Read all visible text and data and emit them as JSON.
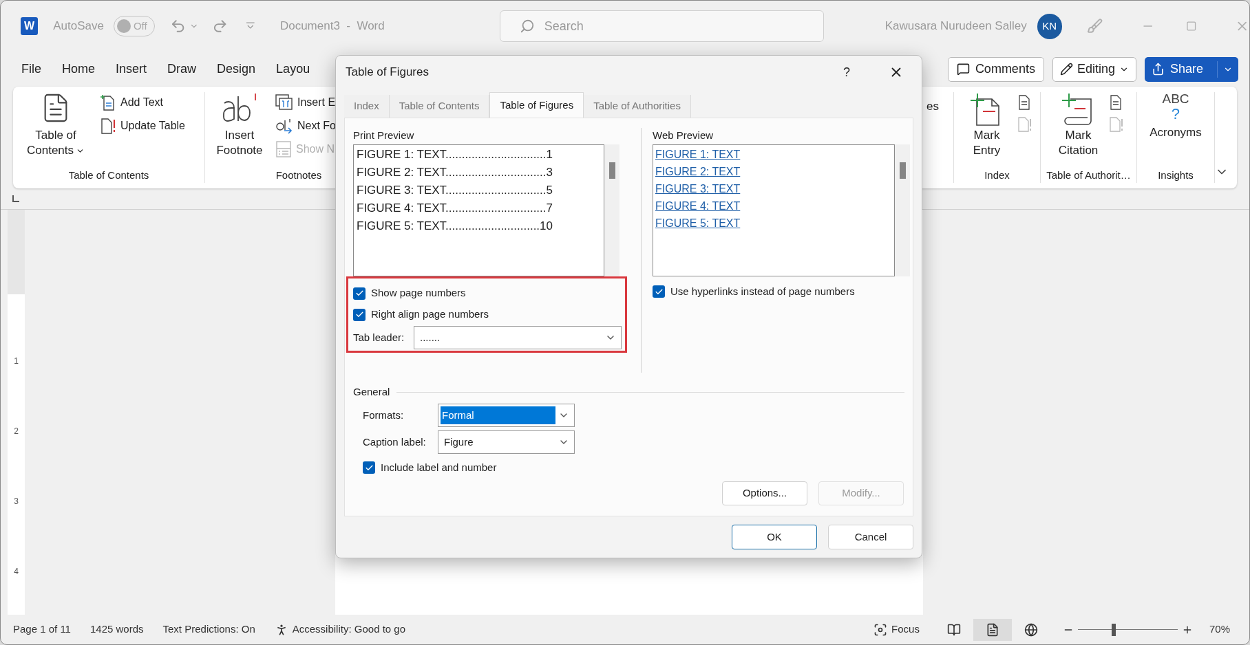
{
  "window": {
    "app_icon": "W",
    "autosave_label": "AutoSave",
    "autosave_toggle": {
      "label": "Off",
      "on": false
    },
    "document_title": "Document3  -  Word",
    "search_placeholder": "Search",
    "user_name": "Kawusara Nurudeen Salley",
    "user_initials": "KN"
  },
  "ribbon_tabs": [
    "File",
    "Home",
    "Insert",
    "Draw",
    "Design",
    "Layou"
  ],
  "header_buttons": [
    {
      "kind": "comments",
      "label": "Comments"
    },
    {
      "kind": "editing",
      "label": "Editing"
    },
    {
      "kind": "share",
      "label": "Share"
    }
  ],
  "ribbon_left": [
    {
      "label": "Table of Contents",
      "large": "Table of Contents",
      "small": [
        {
          "label": "Add Text",
          "kind": "add",
          "disabled": false
        },
        {
          "label": "Update Table",
          "kind": "update",
          "disabled": false
        }
      ]
    },
    {
      "label": "Footnotes",
      "large": "Insert Footnote",
      "small": [
        {
          "label": "Insert E",
          "kind": "endnote",
          "disabled": false
        },
        {
          "label": "Next Fo",
          "kind": "next",
          "disabled": false
        },
        {
          "label": "Show N",
          "kind": "show",
          "disabled": true
        }
      ]
    }
  ],
  "ribbon_cut_text": "es",
  "ribbon_right": [
    {
      "label": "Index",
      "large": "Mark Entry",
      "kind": "entry"
    },
    {
      "label": "Table of Authorit…",
      "large": "Mark Citation",
      "kind": "citation"
    },
    {
      "label": "Insights",
      "large": "Acronyms",
      "kind": "acronyms",
      "icon_text": "ABC",
      "icon_mark": "?"
    }
  ],
  "vertical_ruler": [
    "1",
    "2",
    "3",
    "4"
  ],
  "dialog": {
    "title": "Table of Figures",
    "help": "?",
    "tabs": [
      {
        "label": "Index",
        "selected": false
      },
      {
        "label": "Table of Contents",
        "selected": false
      },
      {
        "label": "Table of Figures",
        "selected": true
      },
      {
        "label": "Table of Authorities",
        "selected": false
      }
    ],
    "print_preview": {
      "label": "Print Preview",
      "lines": [
        "FIGURE 1: TEXT...............................1",
        "FIGURE 2: TEXT...............................3",
        "FIGURE 3: TEXT...............................5",
        "FIGURE 4: TEXT...............................7",
        "FIGURE 5: TEXT.............................10"
      ]
    },
    "web_preview": {
      "label": "Web Preview",
      "links": [
        "FIGURE 1: TEXT",
        "FIGURE 2: TEXT",
        "FIGURE 3: TEXT",
        "FIGURE 4: TEXT",
        "FIGURE 5: TEXT"
      ]
    },
    "highlight_frame": true,
    "options": [
      {
        "label": "Show page numbers",
        "checked": true
      },
      {
        "label": "Right align page numbers",
        "checked": true
      }
    ],
    "tab_leader": {
      "label": "Tab leader:",
      "value": "......."
    },
    "hyperlinks": {
      "label": "Use hyperlinks instead of page numbers",
      "checked": true
    },
    "general": {
      "label": "General",
      "formats": {
        "label": "Formats:",
        "value": "Formal",
        "focused": true
      },
      "caption_label": {
        "label": "Caption label:",
        "value": "Figure",
        "focused": false
      },
      "include": {
        "label": "Include label and number",
        "checked": true
      }
    },
    "buttons": [
      {
        "label": "Options...",
        "disabled": false
      },
      {
        "label": "Modify...",
        "disabled": true
      }
    ],
    "footer_buttons": [
      {
        "label": "OK",
        "default": true
      },
      {
        "label": "Cancel",
        "default": false
      }
    ]
  },
  "status_bar": {
    "items": [
      "Page 1 of 11",
      "1425 words",
      "Text Predictions: On"
    ],
    "accessibility": "Accessibility: Good to go",
    "focus": "Focus",
    "views": [
      {
        "kind": "read",
        "selected": false
      },
      {
        "kind": "print",
        "selected": true
      },
      {
        "kind": "web",
        "selected": false
      }
    ],
    "zoom": {
      "level": 0.36,
      "reading": "70%"
    }
  }
}
